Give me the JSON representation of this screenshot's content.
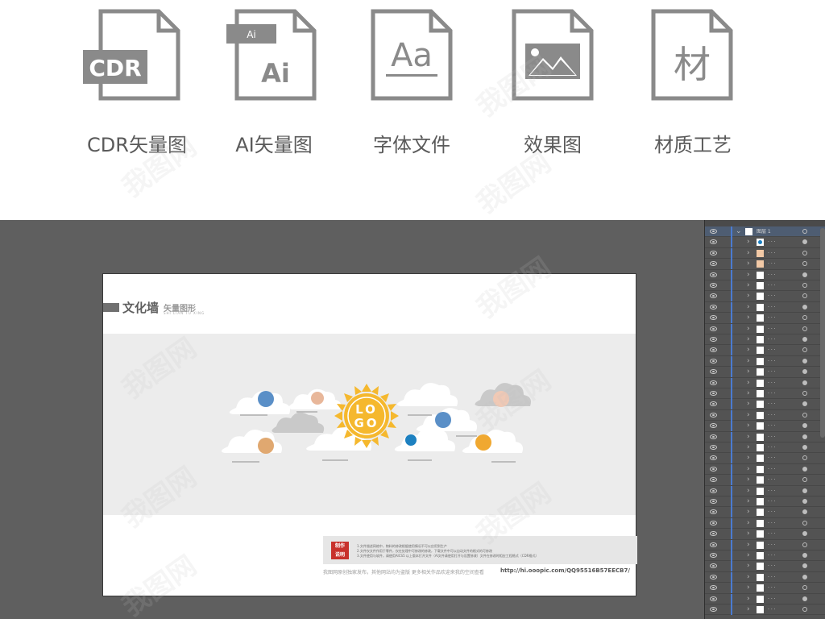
{
  "file_types": [
    {
      "id": "cdr",
      "badge": "CDR",
      "caption": "CDR矢量图",
      "icon": "cdr-file-icon"
    },
    {
      "id": "ai",
      "badge": "Ai",
      "tab": "Ai",
      "caption": "AI矢量图",
      "icon": "ai-file-icon"
    },
    {
      "id": "font",
      "badge": "Aa",
      "caption": "字体文件",
      "icon": "font-file-icon"
    },
    {
      "id": "effect",
      "badge": "",
      "caption": "效果图",
      "icon": "image-file-icon"
    },
    {
      "id": "material",
      "badge": "材",
      "caption": "材质工艺",
      "icon": "material-file-icon"
    }
  ],
  "artboard": {
    "title": "文化墙",
    "subtitle": "矢量图形",
    "subtitle_en": "SHI LIAN TU XING",
    "logo_top": "LO",
    "logo_bottom": "GO",
    "note_stamp_line1": "制作",
    "note_stamp_line2": "说明",
    "note_lines": [
      "1.文件描述网络中，物料的修改根据使用情况不可以应用到生产",
      "2.文件仅文件作用于零件，仅在处理中可修改的修改，下载文件中可以自动文件的格式的可修改",
      "3.文件使用与软件，请使用AICS5 以上版本打开文件（AI文件请使用打开与设置修改）文件在修改时相应工程格式（CDR格式）"
    ],
    "footer_text": "我图网原创独家发布，其他网站均为盗版 更多相关作品欢迎来我的空间查看",
    "footer_url": "http://hi.ooopic.com/QQ95516B57EECB7/"
  },
  "layers_panel": {
    "top_layer_name": "图层 1",
    "child_name": "· · ·",
    "row_count": 36
  },
  "watermark": "我图网",
  "colors": {
    "icon_gray": "#8a8a8a",
    "sun_yellow": "#f5b82e",
    "workspace": "#5f5f5f",
    "layer_selected": "#4e5d72",
    "stamp_red": "#c8312c"
  }
}
